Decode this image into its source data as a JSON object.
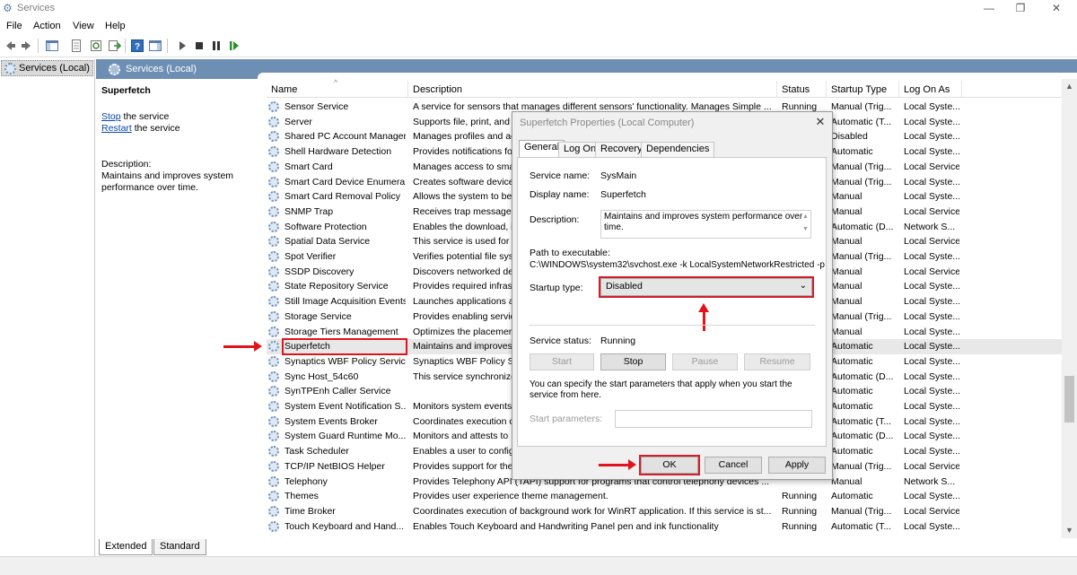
{
  "window": {
    "title": "Services",
    "minimize": "—",
    "maximize": "❐",
    "close": "✕"
  },
  "menu": [
    "File",
    "Action",
    "View",
    "Help"
  ],
  "tree": {
    "node_label": "Services (Local)"
  },
  "pane": {
    "header": "Services (Local)",
    "selected_service": "Superfetch",
    "stop_link": "Stop",
    "stop_suffix": " the service",
    "restart_link": "Restart",
    "restart_suffix": " the service",
    "description_label": "Description:",
    "description_line1": "Maintains and improves system",
    "description_line2": "performance over time."
  },
  "columns": {
    "name": "Name",
    "description": "Description",
    "status": "Status",
    "startup": "Startup Type",
    "logon": "Log On As"
  },
  "rows": [
    {
      "name": "Sensor Service",
      "desc": "A service for sensors that manages different sensors' functionality. Manages Simple ...",
      "status": "Running",
      "startup": "Manual (Trig...",
      "logon": "Local Syste..."
    },
    {
      "name": "Server",
      "desc": "Supports file, print, and",
      "status": "",
      "startup": "Automatic (T...",
      "logon": "Local Syste..."
    },
    {
      "name": "Shared PC Account Manager",
      "desc": "Manages profiles and ac",
      "status": "",
      "startup": "Disabled",
      "logon": "Local Syste..."
    },
    {
      "name": "Shell Hardware Detection",
      "desc": "Provides notifications fo",
      "status": "",
      "startup": "Automatic",
      "logon": "Local Syste..."
    },
    {
      "name": "Smart Card",
      "desc": "Manages access to sma",
      "status": "",
      "startup": "Manual (Trig...",
      "logon": "Local Service"
    },
    {
      "name": "Smart Card Device Enumera...",
      "desc": "Creates software device",
      "status": "",
      "startup": "Manual (Trig...",
      "logon": "Local Syste..."
    },
    {
      "name": "Smart Card Removal Policy",
      "desc": "Allows the system to be",
      "status": "",
      "startup": "Manual",
      "logon": "Local Syste..."
    },
    {
      "name": "SNMP Trap",
      "desc": "Receives trap messages",
      "status": "",
      "startup": "Manual",
      "logon": "Local Service"
    },
    {
      "name": "Software Protection",
      "desc": "Enables the download, i",
      "status": "",
      "startup": "Automatic (D...",
      "logon": "Network S..."
    },
    {
      "name": "Spatial Data Service",
      "desc": "This service is used for",
      "status": "",
      "startup": "Manual",
      "logon": "Local Service"
    },
    {
      "name": "Spot Verifier",
      "desc": "Verifies potential file sys",
      "status": "",
      "startup": "Manual (Trig...",
      "logon": "Local Syste..."
    },
    {
      "name": "SSDP Discovery",
      "desc": "Discovers networked de",
      "status": "",
      "startup": "Manual",
      "logon": "Local Service"
    },
    {
      "name": "State Repository Service",
      "desc": "Provides required infrast",
      "status": "",
      "startup": "Manual",
      "logon": "Local Syste..."
    },
    {
      "name": "Still Image Acquisition Events",
      "desc": "Launches applications a",
      "status": "",
      "startup": "Manual",
      "logon": "Local Syste..."
    },
    {
      "name": "Storage Service",
      "desc": "Provides enabling servic",
      "status": "",
      "startup": "Manual (Trig...",
      "logon": "Local Syste..."
    },
    {
      "name": "Storage Tiers Management",
      "desc": "Optimizes the placemer",
      "status": "",
      "startup": "Manual",
      "logon": "Local Syste..."
    },
    {
      "name": "Superfetch",
      "desc": "Maintains and improves",
      "status": "",
      "startup": "Automatic",
      "logon": "Local Syste..."
    },
    {
      "name": "Synaptics WBF Policy Service",
      "desc": "Synaptics WBF Policy Se",
      "status": "",
      "startup": "Automatic",
      "logon": "Local Syste..."
    },
    {
      "name": "Sync Host_54c60",
      "desc": "This service synchronize",
      "status": "",
      "startup": "Automatic (D...",
      "logon": "Local Syste..."
    },
    {
      "name": "SynTPEnh Caller Service",
      "desc": "",
      "status": "",
      "startup": "Automatic",
      "logon": "Local Syste..."
    },
    {
      "name": "System Event Notification S...",
      "desc": "Monitors system events",
      "status": "",
      "startup": "Automatic",
      "logon": "Local Syste..."
    },
    {
      "name": "System Events Broker",
      "desc": "Coordinates execution c",
      "status": "",
      "startup": "Automatic (T...",
      "logon": "Local Syste..."
    },
    {
      "name": "System Guard Runtime Mo...",
      "desc": "Monitors and attests to",
      "status": "",
      "startup": "Automatic (D...",
      "logon": "Local Syste..."
    },
    {
      "name": "Task Scheduler",
      "desc": "Enables a user to config",
      "status": "",
      "startup": "Automatic",
      "logon": "Local Syste..."
    },
    {
      "name": "TCP/IP NetBIOS Helper",
      "desc": "Provides support for the",
      "status": "",
      "startup": "Manual (Trig...",
      "logon": "Local Service"
    },
    {
      "name": "Telephony",
      "desc": "Provides Telephony API (TAPI) support for programs that control telephony devices ...",
      "status": "",
      "startup": "Manual",
      "logon": "Network S..."
    },
    {
      "name": "Themes",
      "desc": "Provides user experience theme management.",
      "status": "Running",
      "startup": "Automatic",
      "logon": "Local Syste..."
    },
    {
      "name": "Time Broker",
      "desc": "Coordinates execution of background work for WinRT application. If this service is st...",
      "status": "Running",
      "startup": "Manual (Trig...",
      "logon": "Local Service"
    },
    {
      "name": "Touch Keyboard and Hand...",
      "desc": "Enables Touch Keyboard and Handwriting Panel pen and ink functionality",
      "status": "Running",
      "startup": "Automatic (T...",
      "logon": "Local Syste..."
    }
  ],
  "bottom_tabs": [
    "Extended",
    "Standard"
  ],
  "dialog": {
    "title": "Superfetch Properties (Local Computer)",
    "close": "✕",
    "tabs": [
      "General",
      "Log On",
      "Recovery",
      "Dependencies"
    ],
    "service_name_label": "Service name:",
    "service_name": "SysMain",
    "display_name_label": "Display name:",
    "display_name": "Superfetch",
    "description_label": "Description:",
    "description": "Maintains and improves system performance over time.",
    "path_label": "Path to executable:",
    "path": "C:\\WINDOWS\\system32\\svchost.exe -k LocalSystemNetworkRestricted -p",
    "startup_type_label": "Startup type:",
    "startup_type": "Disabled",
    "service_status_label": "Service status:",
    "service_status": "Running",
    "start_btn": "Start",
    "stop_btn": "Stop",
    "pause_btn": "Pause",
    "resume_btn": "Resume",
    "hint": "You can specify the start parameters that apply when you start the service from here.",
    "start_params_label": "Start parameters:",
    "start_params_value": "",
    "ok_btn": "OK",
    "cancel_btn": "Cancel",
    "apply_btn": "Apply"
  },
  "colors": {
    "pane_header": "#6e8fb4",
    "annotation_red": "#e1141c",
    "link": "#0645ad"
  }
}
